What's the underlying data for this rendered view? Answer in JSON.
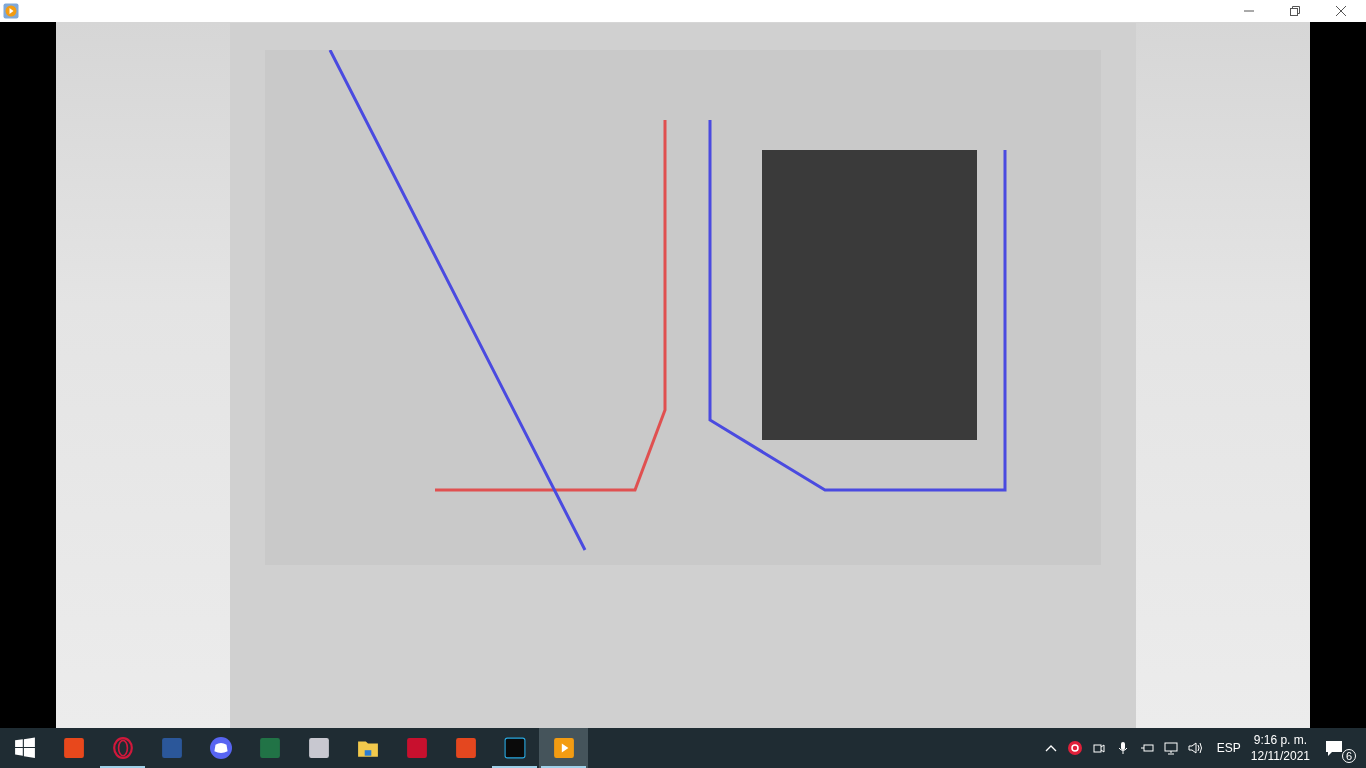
{
  "taskbar": {
    "apps": [
      {
        "kind": "start",
        "running": false,
        "active": false
      },
      {
        "kind": "office",
        "running": false,
        "active": false
      },
      {
        "kind": "opera",
        "running": true,
        "active": false
      },
      {
        "kind": "word",
        "running": false,
        "active": false
      },
      {
        "kind": "discord",
        "running": false,
        "active": false
      },
      {
        "kind": "excel",
        "running": false,
        "active": false
      },
      {
        "kind": "snip",
        "running": false,
        "active": false
      },
      {
        "kind": "folder",
        "running": false,
        "active": false
      },
      {
        "kind": "autocad",
        "running": false,
        "active": false
      },
      {
        "kind": "acrobat",
        "running": false,
        "active": false
      },
      {
        "kind": "vegas",
        "running": true,
        "active": false
      },
      {
        "kind": "player",
        "running": true,
        "active": true
      }
    ],
    "tray": {
      "language": "ESP",
      "time": "9:16 p. m.",
      "date": "12/11/2021",
      "notifications": "6"
    }
  }
}
